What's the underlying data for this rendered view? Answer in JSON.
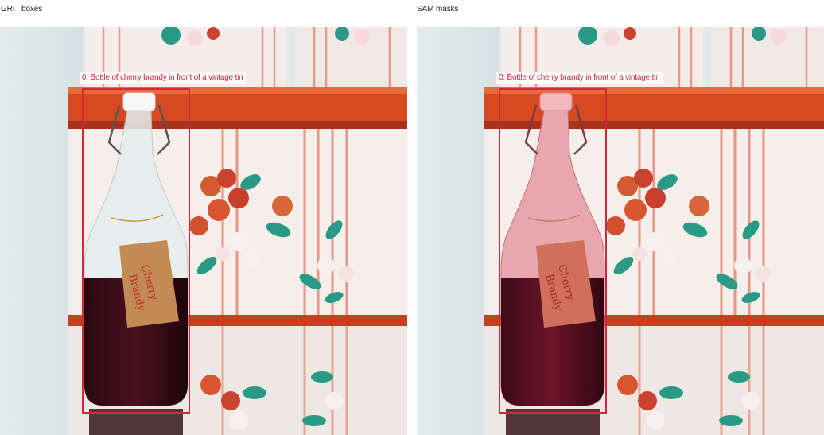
{
  "panels": [
    {
      "title": "GRIT boxes",
      "detection_label": "0: Bottle of cherry brandy in front of a vintage tin",
      "mask_color": ""
    },
    {
      "title": "SAM masks",
      "detection_label": "0: Bottle of cherry brandy in front of a vintage tin",
      "mask_color": "#e04a5c"
    }
  ],
  "tag_text": {
    "line1": "Cherry",
    "line2": "Brandy"
  },
  "colors": {
    "box": "#d2283c",
    "label_text": "#c22a3a"
  }
}
